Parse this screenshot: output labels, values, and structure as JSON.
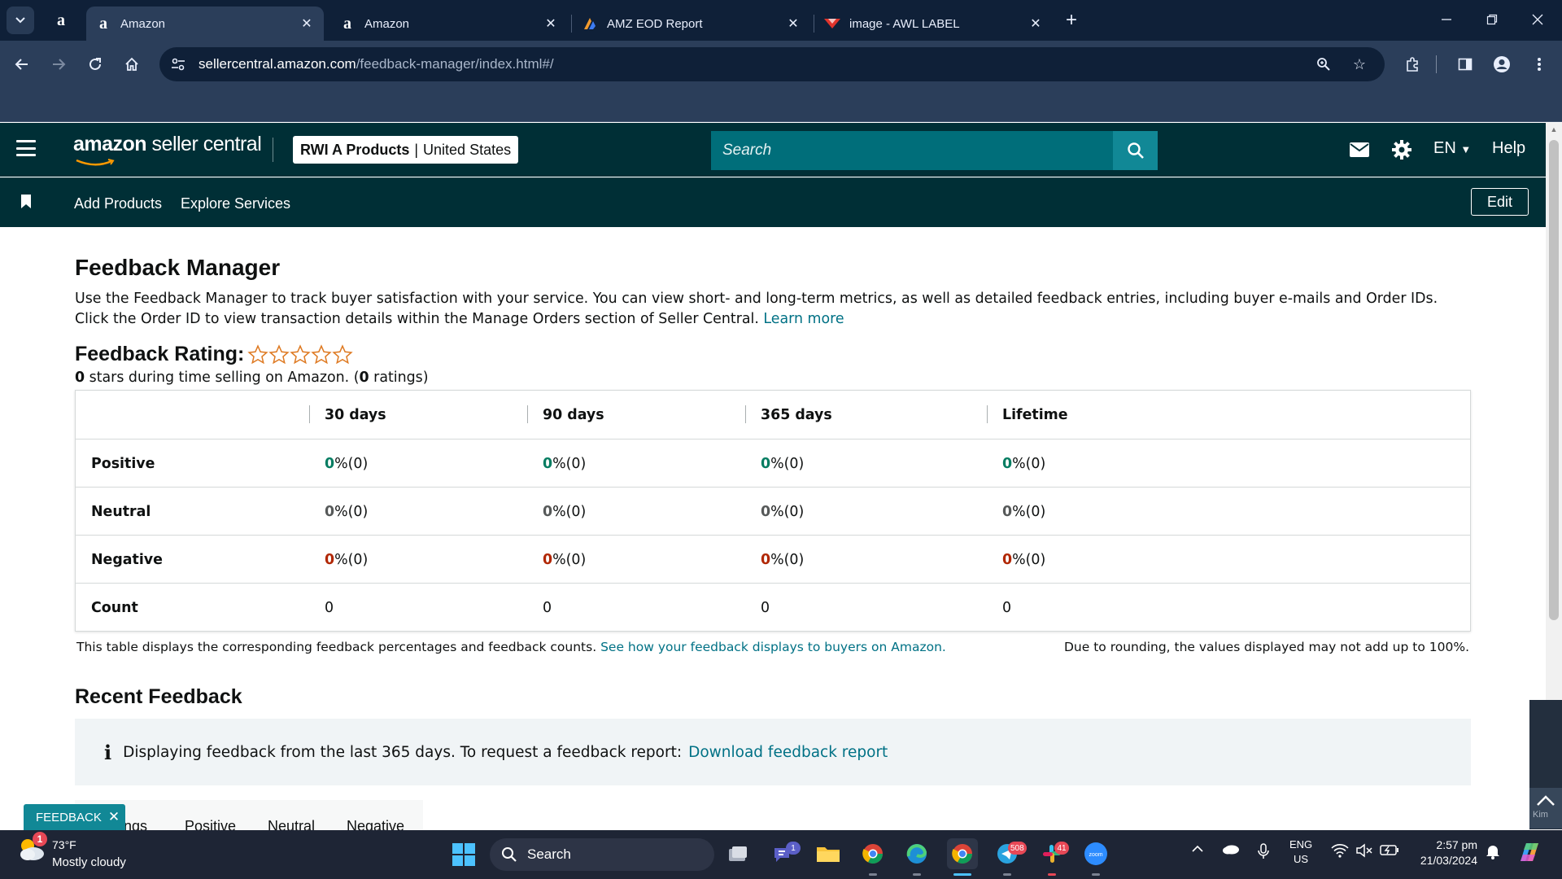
{
  "browser": {
    "tabs": [
      {
        "title": "Amazon",
        "favicon": "amazon-icon",
        "active": true
      },
      {
        "title": "Amazon",
        "favicon": "amazon-icon",
        "active": false
      },
      {
        "title": "AMZ EOD Report",
        "favicon": "orange-blue-logo-icon",
        "active": false
      },
      {
        "title": "image - AWL LABEL",
        "favicon": "red-logo-icon",
        "active": false
      }
    ],
    "url_host": "sellercentral.amazon.com",
    "url_path": "/feedback-manager/index.html#/"
  },
  "header": {
    "logo_amazon": "amazon",
    "logo_rest": " seller central",
    "store_name": "RWI A Products",
    "store_separator": "|",
    "marketplace": "United States",
    "search_placeholder": "Search",
    "language": "EN",
    "help": "Help"
  },
  "nav": {
    "links": [
      "Add Products",
      "Explore Services"
    ],
    "edit": "Edit"
  },
  "page": {
    "title": "Feedback Manager",
    "intro": "Use the Feedback Manager to track buyer satisfaction with your service. You can view short- and long-term metrics, as well as detailed feedback entries, including buyer e-mails and Order IDs. Click the Order ID to view transaction details within the Manage Orders section of Seller Central.",
    "learn_more": "Learn more",
    "rating_label": "Feedback Rating:",
    "rating_stars_filled": 0,
    "rating_stars_total": 5,
    "rating_value": "0",
    "rating_text_mid": " stars during time selling on Amazon. (",
    "rating_count": "0",
    "rating_text_end": " ratings)"
  },
  "feedback_table": {
    "columns": [
      "30 days",
      "90 days",
      "365 days",
      "Lifetime"
    ],
    "rows": [
      {
        "label": "Positive",
        "kind": "pos",
        "cells": [
          {
            "pct": "0",
            "rest": " %(0)"
          },
          {
            "pct": "0",
            "rest": " %(0)"
          },
          {
            "pct": "0",
            "rest": " %(0)"
          },
          {
            "pct": "0",
            "rest": " %(0)"
          }
        ]
      },
      {
        "label": "Neutral",
        "kind": "neu",
        "cells": [
          {
            "pct": "0",
            "rest": " %(0)"
          },
          {
            "pct": "0",
            "rest": " %(0)"
          },
          {
            "pct": "0",
            "rest": " %(0)"
          },
          {
            "pct": "0",
            "rest": " %(0)"
          }
        ]
      },
      {
        "label": "Negative",
        "kind": "neg",
        "cells": [
          {
            "pct": "0",
            "rest": " %(0)"
          },
          {
            "pct": "0",
            "rest": " %(0)"
          },
          {
            "pct": "0",
            "rest": " %(0)"
          },
          {
            "pct": "0",
            "rest": " %(0)"
          }
        ]
      }
    ],
    "count_row": {
      "label": "Count",
      "values": [
        "0",
        "0",
        "0",
        "0"
      ]
    },
    "note_left": "This table displays the corresponding feedback percentages and feedback counts. ",
    "note_link": "See how your feedback displays to buyers on Amazon.",
    "note_right": "Due to rounding, the values displayed may not add up to 100%."
  },
  "recent": {
    "title": "Recent Feedback",
    "info_text": "Displaying feedback from the last 365 days. To request a feedback report: ",
    "info_link": "Download feedback report",
    "tabs": [
      "ings",
      "Positive",
      "Neutral",
      "Negative"
    ]
  },
  "feedback_widget": {
    "label": "FEEDBACK",
    "close": "✕"
  },
  "side_widget": {
    "label": "Kim"
  },
  "taskbar": {
    "weather_badge": "1",
    "temperature": "73°F",
    "weather": "Mostly cloudy",
    "search": "Search",
    "badges": {
      "teams": "1",
      "telegram": "508",
      "slack": "41"
    },
    "zoom_label": "zoom",
    "lang_line1": "ENG",
    "lang_line2": "US",
    "time": "2:57 pm",
    "date": "21/03/2024"
  },
  "colors": {
    "chrome_dark": "#0f2038",
    "chrome_toolbar": "#2b3e5a",
    "sc_header": "#002f36",
    "search_bg": "#006e7a",
    "positive": "#067d62",
    "negative": "#b12704",
    "link": "#007185"
  }
}
